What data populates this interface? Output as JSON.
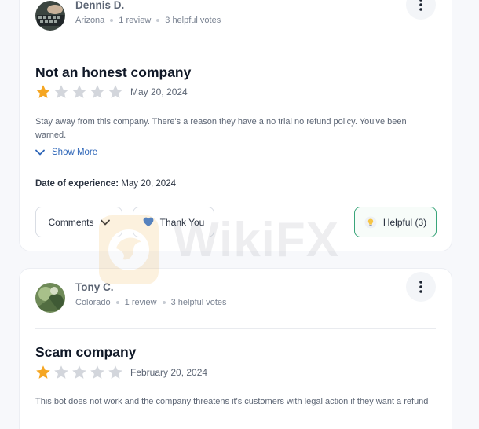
{
  "reviews": [
    {
      "user": "Dennis D.",
      "location": "Arizona",
      "reviews_count": "1 review",
      "helpful_votes": "3 helpful votes",
      "title": "Not an honest company",
      "rating": 1,
      "rating_max": 5,
      "date": "May 20, 2024",
      "body": "Stay away from this company. There's a reason they have a no trial no refund policy. You've been warned.",
      "show_more_label": "Show More",
      "experience_label": "Date of experience:",
      "experience_date": "May 20, 2024",
      "actions": {
        "comments_label": "Comments",
        "thanks_label": "Thank You",
        "helpful_label": "Helpful (3)"
      }
    },
    {
      "user": "Tony C.",
      "location": "Colorado",
      "reviews_count": "1 review",
      "helpful_votes": "3 helpful votes",
      "title": "Scam company",
      "rating": 1,
      "rating_max": 5,
      "date": "February 20, 2024",
      "body": "This bot does not work and the company threatens it's customers with legal action if they want a refund"
    }
  ],
  "watermark": {
    "text": "WikiFX"
  },
  "colors": {
    "star_filled": "#f5a623",
    "star_empty": "#d3d6dc",
    "link": "#2e66b8",
    "helpful_border": "#39a57a",
    "heart": "#3d7ed9"
  },
  "icons": {
    "more": "vertical-dots-icon",
    "expand": "chevron-down-icon",
    "thanks": "heart-icon",
    "helpful": "lightbulb-icon"
  }
}
